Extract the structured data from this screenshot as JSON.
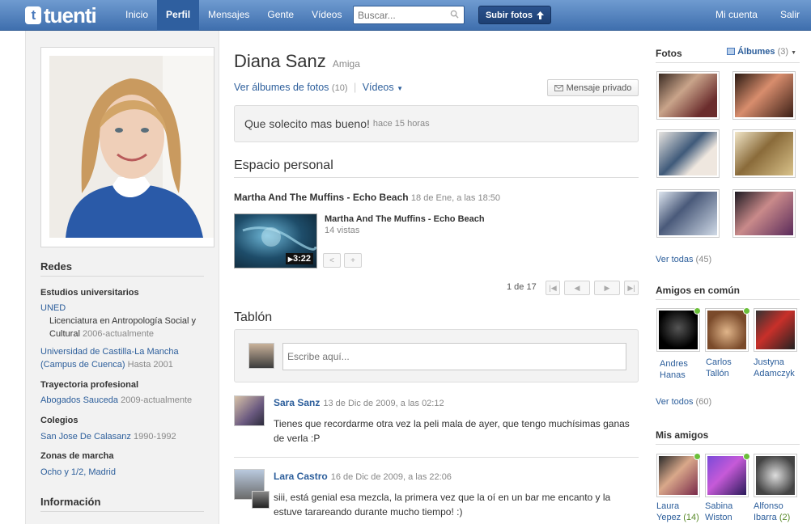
{
  "app": {
    "logo_text": "tuenti",
    "logo_icon": "tuenti-logo-icon"
  },
  "nav": {
    "items": [
      "Inicio",
      "Perfil",
      "Mensajes",
      "Gente",
      "Vídeos"
    ],
    "active": "Perfil"
  },
  "search": {
    "placeholder": "Buscar..."
  },
  "upload_button": "Subir fotos",
  "right_nav": [
    "Mi cuenta",
    "Salir"
  ],
  "profile": {
    "name": "Diana Sanz",
    "relation": "Amiga",
    "albums_link": "Ver álbumes de fotos",
    "albums_count": "(10)",
    "videos_link": "Vídeos",
    "private_message": "Mensaje privado",
    "status_text": "Que solecito mas bueno!",
    "status_time": "hace 15 horas"
  },
  "left": {
    "networks_title": "Redes",
    "university_label": "Estudios universitarios",
    "university_1": "UNED",
    "university_1_degree": "Licenciatura en Antropología Social y Cultural",
    "university_1_years": "2006-actualmente",
    "university_2": "Universidad de Castilla-La Mancha (Campus de Cuenca)",
    "university_2_years": "Hasta 2001",
    "career_label": "Trayectoria profesional",
    "career_1": "Abogados Sauceda",
    "career_1_years": "2009-actualmente",
    "schools_label": "Colegios",
    "school_1": "San Jose De Calasanz",
    "school_1_years": "1990-1992",
    "zones_label": "Zonas de marcha",
    "zone_1": "Ocho y 1/2",
    "zone_sep": ",",
    "zone_2": "Madrid",
    "info_title": "Información"
  },
  "personal_space": {
    "title": "Espacio personal",
    "entry_title": "Martha And The Muffins - Echo Beach",
    "entry_date": "18 de Ene, a las 18:50",
    "video_title": "Martha And The Muffins - Echo Beach",
    "video_views": "14 vistas",
    "video_duration": "3:22",
    "pager_text": "1 de 17"
  },
  "wall": {
    "title": "Tablón",
    "placeholder": "Escribe aquí...",
    "comments": [
      {
        "author": "Sara Sanz",
        "date": "13 de Dic de 2009, a las 02:12",
        "text": "Tienes que recordarme otra vez la peli mala de ayer, que tengo muchísimas ganas de verla :P"
      },
      {
        "author": "Lara Castro",
        "date": "16 de Dic de 2009, a las 22:06",
        "text": "siii, está genial esa mezcla, la primera vez que la oí en un bar me encanto y la estuve tarareando durante mucho tiempo! :)"
      }
    ]
  },
  "photos": {
    "title": "Fotos",
    "albums_label": "Álbumes",
    "albums_count": "(3)",
    "see_all": "Ver todas",
    "see_all_count": "(45)"
  },
  "common_friends": {
    "title": "Amigos en común",
    "friends": [
      {
        "first": "Andres",
        "last": "Hanas"
      },
      {
        "first": "Carlos",
        "last": "Tallón"
      },
      {
        "first": "Justyna",
        "last": "Adamczyk"
      }
    ],
    "see_all": "Ver todos",
    "see_all_count": "(60)"
  },
  "my_friends": {
    "title": "Mis amigos",
    "friends": [
      {
        "first": "Laura",
        "last": "Yepez",
        "count": "(14)"
      },
      {
        "first": "Sabina",
        "last": "Wiston",
        "count": ""
      },
      {
        "first": "Alfonso",
        "last": "Ibarra",
        "count": "(2)"
      }
    ]
  },
  "colors": {
    "topbar": "#4b7bbd",
    "link": "#2c5e9b",
    "online": "#6bbf3a"
  }
}
